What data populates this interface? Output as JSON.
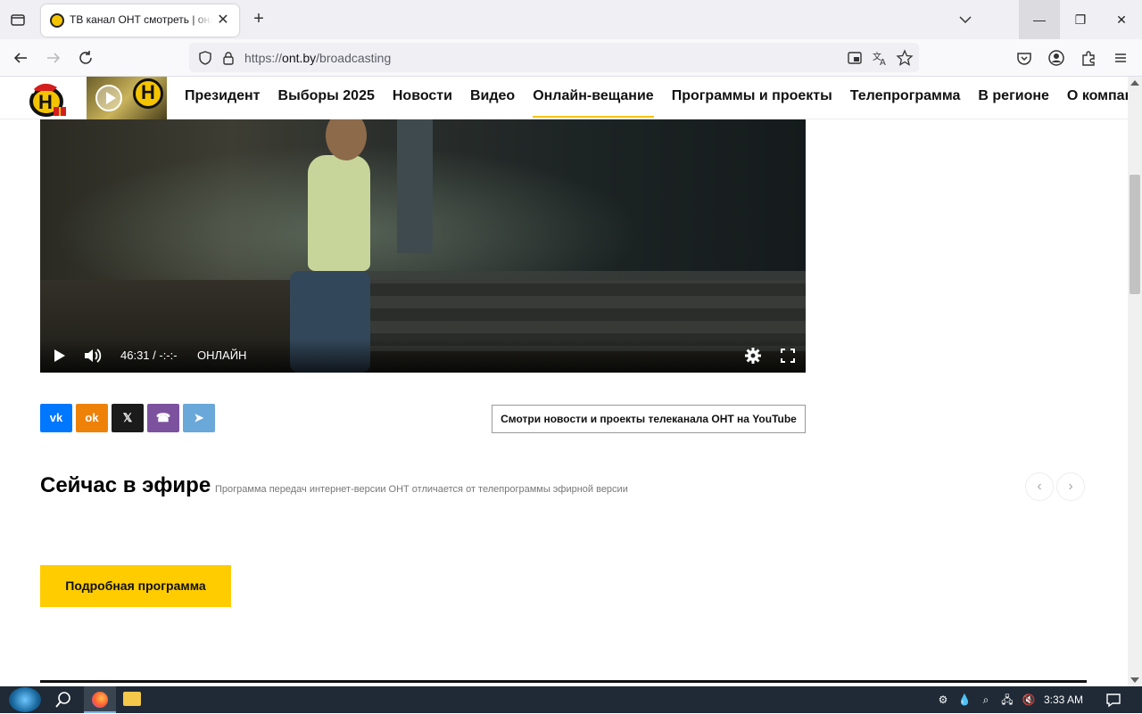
{
  "browser": {
    "tab_title": "ТВ канал ОНТ смотреть | онлайн",
    "tab_close": "✕",
    "new_tab": "+",
    "url_scheme": "https://",
    "url_host": "ont.by",
    "url_path": "/broadcasting",
    "win_min": "—",
    "win_max": "❐",
    "win_close": "✕"
  },
  "site": {
    "logo_letter": "Н",
    "nav": [
      {
        "label": "Президент"
      },
      {
        "label": "Выборы 2025"
      },
      {
        "label": "Новости"
      },
      {
        "label": "Видео"
      },
      {
        "label": "Онлайн-вещание"
      },
      {
        "label": "Программы и проекты"
      },
      {
        "label": "Телепрограмма"
      },
      {
        "label": "В регионе"
      },
      {
        "label": "О компании"
      }
    ]
  },
  "player": {
    "time": "46:31 / -:-:-",
    "live_label": "ОНЛАЙН"
  },
  "share": {
    "vk": "vk",
    "ok": "ok",
    "x": "𝕏",
    "viber": "☎",
    "telegram": "➤"
  },
  "youtube_button": "Смотри новости и проекты телеканала ОНТ на YouTube",
  "on_air": {
    "title": "Сейчас в эфире",
    "note": "Программа передач интернет-версии ОНТ отличается от телепрограммы эфирной версии",
    "prev": "‹",
    "next": "›"
  },
  "program_button": "Подробная программа",
  "taskbar": {
    "clock": "3:33 AM"
  },
  "colors": {
    "accent": "#ffcc00",
    "vk": "#0077ff",
    "ok": "#ee8208",
    "x": "#1b1b1b",
    "viber": "#7c529e",
    "telegram": "#6aa8d9"
  }
}
